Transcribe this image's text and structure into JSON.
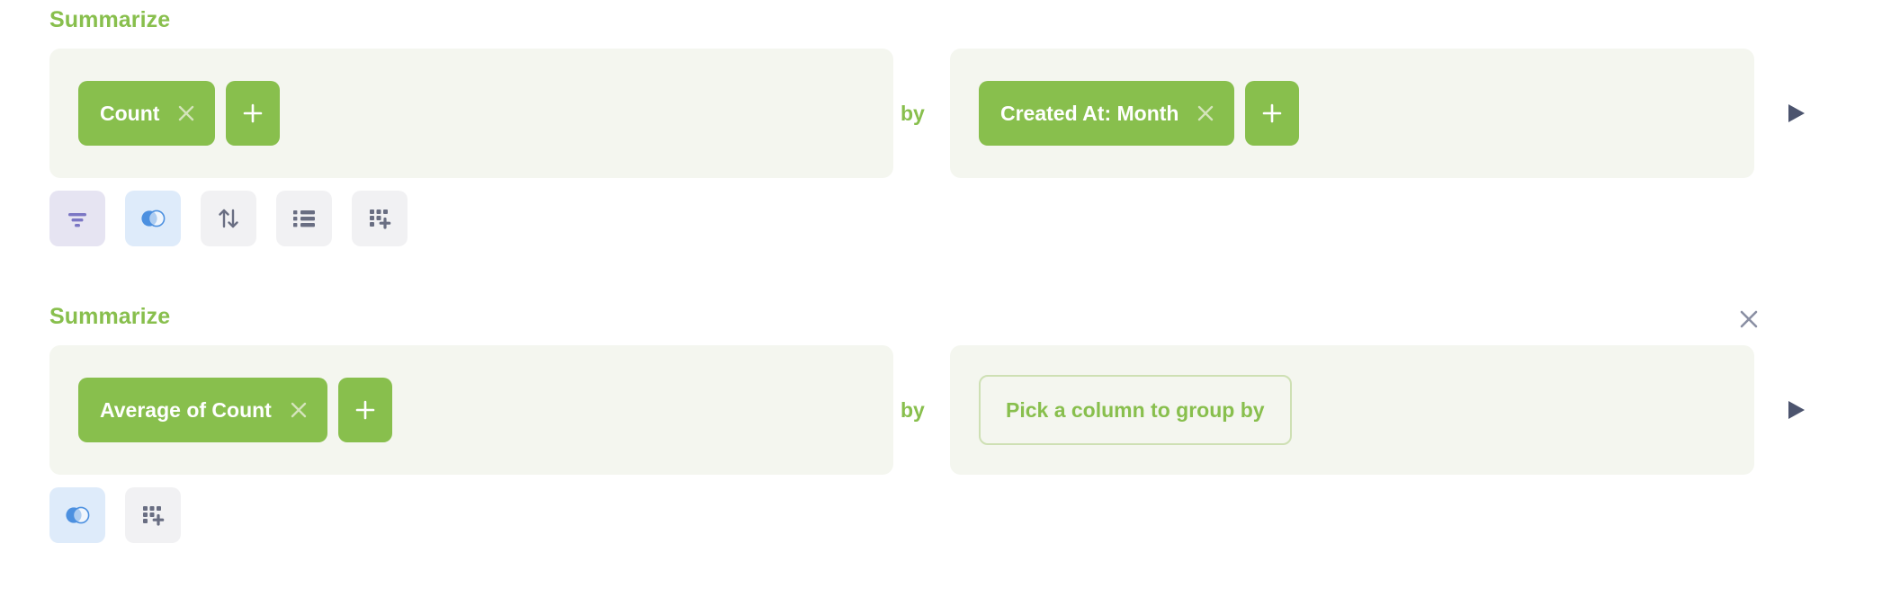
{
  "theme": {
    "brand_green": "#88BF4D",
    "panel_bg": "#F4F6EF",
    "placeholder_border": "#CEE0B4",
    "icon_neutral_bg": "#F1F1F3",
    "icon_filter_bg": "#E6E4F2",
    "icon_summarize_bg": "#DEEBFA",
    "filter_icon_color": "#7B76C4",
    "summarize_icon_color": "#4C90E0",
    "neutral_icon_color": "#696E82",
    "run_button_color": "#4C546E",
    "close_icon_color": "#8A8FA3"
  },
  "sections": [
    {
      "title": "Summarize",
      "has_close": false,
      "close_icon": "close-icon",
      "aggregation": {
        "pills": [
          {
            "label": "Count",
            "remove_icon": "close-icon"
          }
        ],
        "add_icon": "plus-icon",
        "add_label": "+"
      },
      "by_label": "by",
      "breakout": {
        "pills": [
          {
            "label": "Created At: Month",
            "remove_icon": "close-icon"
          }
        ],
        "add_icon": "plus-icon",
        "add_label": "+",
        "placeholder": null
      },
      "run_icon": "play-icon",
      "actions": [
        {
          "name": "filter",
          "icon": "filter-icon",
          "variant": "filter-variant"
        },
        {
          "name": "summarize",
          "icon": "summarize-icon",
          "variant": "summarize-variant"
        },
        {
          "name": "sort",
          "icon": "sort-icon",
          "variant": "neutral"
        },
        {
          "name": "row-limit",
          "icon": "list-icon",
          "variant": "neutral"
        },
        {
          "name": "join-data",
          "icon": "join-data-icon",
          "variant": "neutral"
        }
      ]
    },
    {
      "title": "Summarize",
      "has_close": true,
      "close_icon": "close-icon",
      "aggregation": {
        "pills": [
          {
            "label": "Average of Count",
            "remove_icon": "close-icon"
          }
        ],
        "add_icon": "plus-icon",
        "add_label": "+"
      },
      "by_label": "by",
      "breakout": {
        "pills": [],
        "add_icon": null,
        "add_label": null,
        "placeholder": "Pick a column to group by"
      },
      "run_icon": "play-icon",
      "actions": [
        {
          "name": "summarize",
          "icon": "summarize-icon",
          "variant": "summarize-variant"
        },
        {
          "name": "join-data",
          "icon": "join-data-icon",
          "variant": "neutral"
        }
      ]
    }
  ]
}
